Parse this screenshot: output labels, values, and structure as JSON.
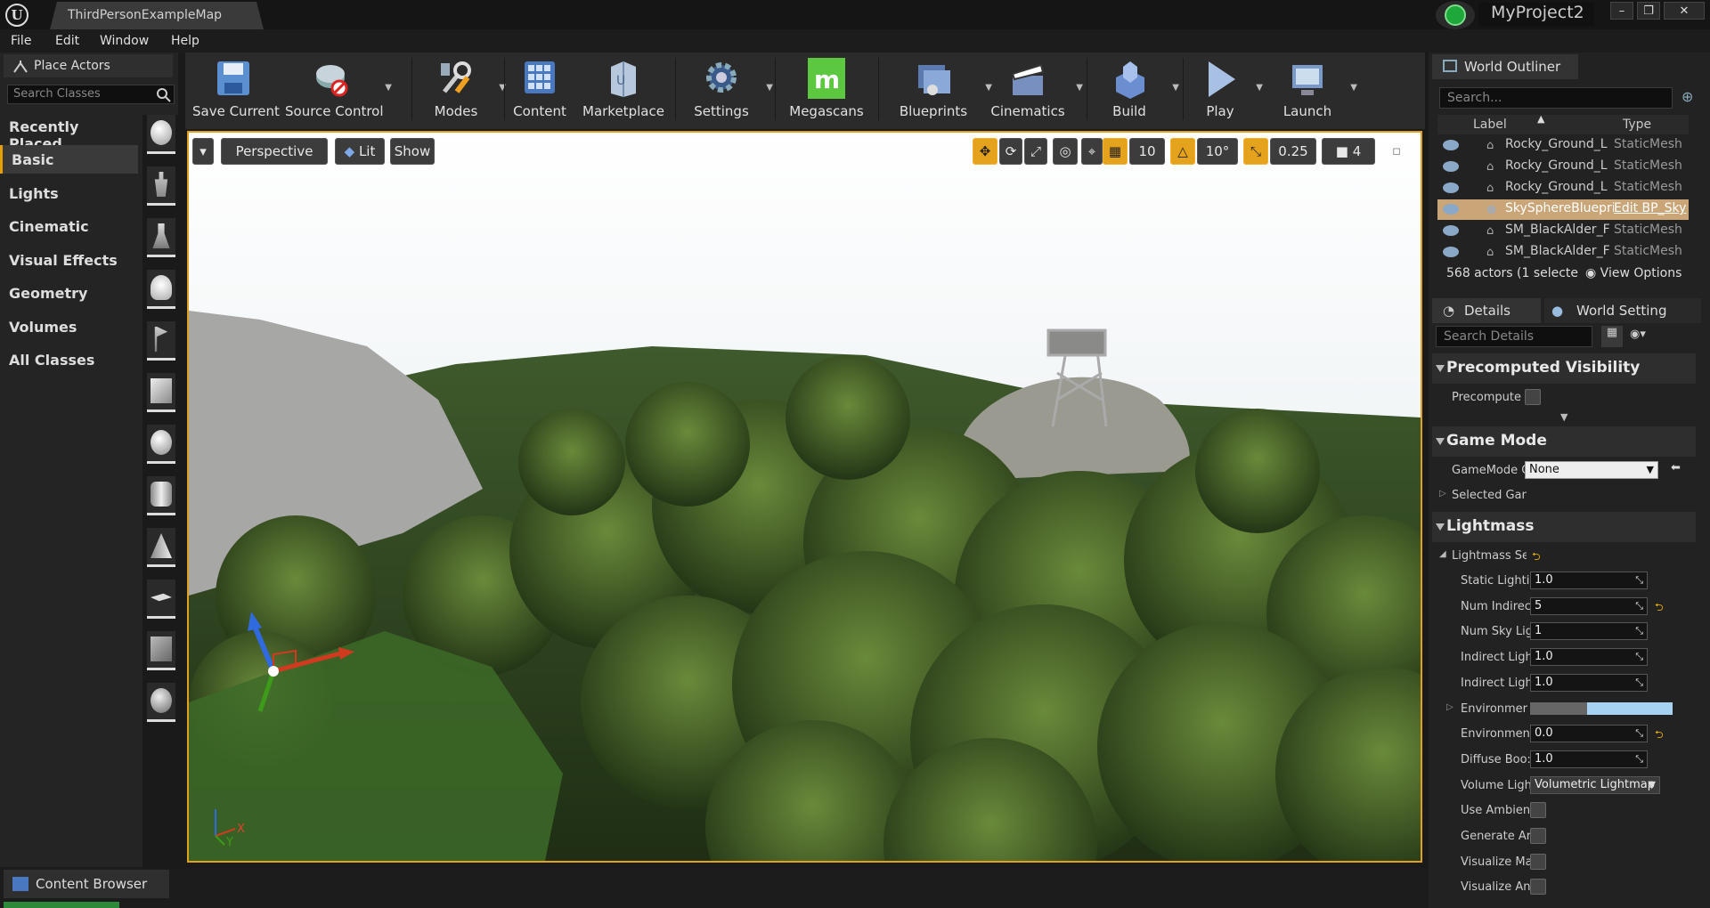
{
  "window": {
    "tab_title": "ThirdPersonExampleMap",
    "project_name": "MyProject2",
    "controls": [
      "–",
      "❐",
      "✕"
    ]
  },
  "menu": [
    "File",
    "Edit",
    "Window",
    "Help"
  ],
  "place_actors": {
    "tab_label": "Place Actors",
    "search_placeholder": "Search Classes",
    "categories": [
      "Recently Placed",
      "Basic",
      "Lights",
      "Cinematic",
      "Visual Effects",
      "Geometry",
      "Volumes",
      "All Classes"
    ],
    "selected_category": "Basic"
  },
  "toolbar": {
    "items": [
      "Save Current",
      "Source Control",
      "Modes",
      "Content",
      "Marketplace",
      "Settings",
      "Megascans",
      "Blueprints",
      "Cinematics",
      "Build",
      "Play",
      "Launch"
    ]
  },
  "viewport": {
    "view_mode": "Perspective",
    "lighting": "Lit",
    "show": "Show",
    "grid_snap": "10",
    "rotation_snap": "10°",
    "scale_snap": "0.25",
    "camera_speed": "4",
    "axis_x": "X",
    "axis_y": "Y"
  },
  "outliner": {
    "tab_label": "World Outliner",
    "search_placeholder": "Search...",
    "col_label": "Label",
    "col_type": "Type",
    "rows": [
      {
        "name": "Rocky_Ground_L",
        "type": "StaticMesh"
      },
      {
        "name": "Rocky_Ground_L",
        "type": "StaticMesh"
      },
      {
        "name": "Rocky_Ground_L",
        "type": "StaticMesh"
      },
      {
        "name": "SkySphereBlueprint",
        "type": "Edit BP_Sky"
      },
      {
        "name": "SM_BlackAlder_F",
        "type": "StaticMesh"
      },
      {
        "name": "SM_BlackAlder_F",
        "type": "StaticMesh"
      }
    ],
    "status": "568 actors (1 selecte",
    "view_options": "View Options"
  },
  "details": {
    "tab_label": "Details",
    "tab2_label": "World Setting",
    "search_placeholder": "Search Details",
    "sections": {
      "precomputed": "Precomputed Visibility",
      "game_mode": "Game Mode",
      "lightmass": "Lightmass"
    },
    "precompute_label": "Precompute V",
    "gamemode_label": "GameMode O",
    "gamemode_value": "None",
    "selected_game": "Selected Gan",
    "lightmass_settings": "Lightmass Set",
    "props": [
      {
        "label": "Static Lightii",
        "value": "1.0"
      },
      {
        "label": "Num Indirec",
        "value": "5"
      },
      {
        "label": "Num Sky Lig",
        "value": "1"
      },
      {
        "label": "Indirect Ligh",
        "value": "1.0"
      },
      {
        "label": "Indirect Ligh",
        "value": "1.0"
      },
      {
        "label": "Environmer",
        "value": ""
      },
      {
        "label": "Environmen",
        "value": "0.0"
      },
      {
        "label": "Diffuse Boo:",
        "value": "1.0"
      },
      {
        "label": "Volume Ligh",
        "value": "Volumetric Lightmap"
      },
      {
        "label": "Use Ambien",
        "value": ""
      },
      {
        "label": "Generate Ar",
        "value": ""
      },
      {
        "label": "Visualize Ma",
        "value": ""
      },
      {
        "label": "Visualize An",
        "value": ""
      }
    ]
  },
  "content_browser": {
    "tab_label": "Content Browser"
  }
}
